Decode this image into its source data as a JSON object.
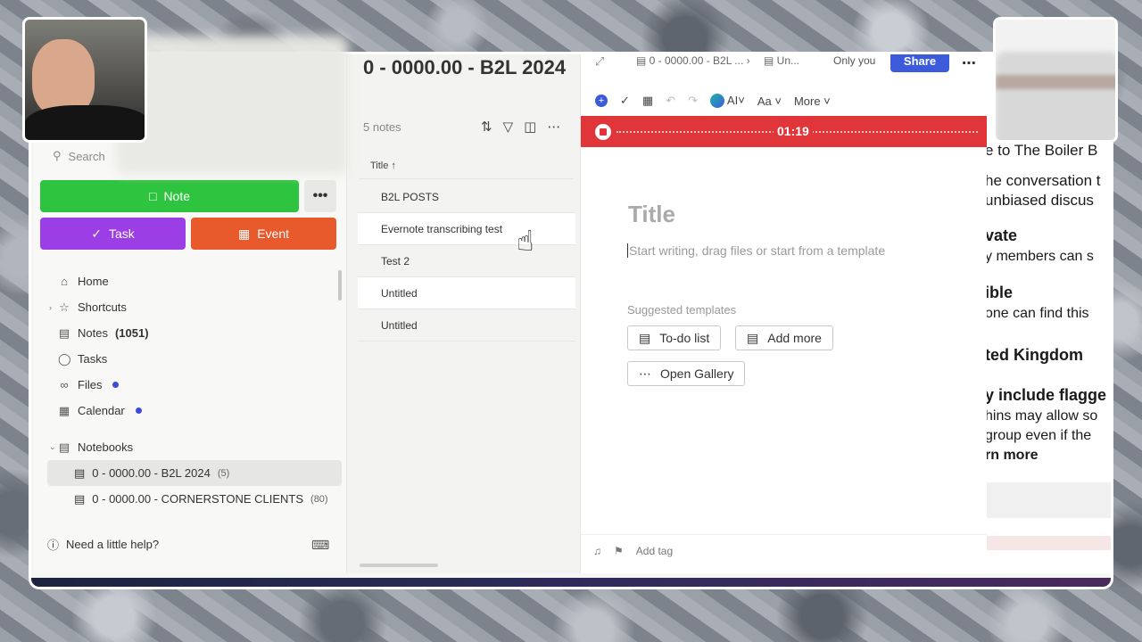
{
  "sidebar": {
    "search_placeholder": "Search",
    "buttons": {
      "note": "Note",
      "more": "•••",
      "task": "Task",
      "event": "Event"
    },
    "nav": [
      {
        "label": "Home",
        "icon": "home-icon"
      },
      {
        "label": "Shortcuts",
        "icon": "star-icon"
      },
      {
        "label": "Notes",
        "count": "(1051)",
        "icon": "note-icon"
      },
      {
        "label": "Tasks",
        "icon": "check-circle-icon"
      },
      {
        "label": "Files",
        "icon": "paperclip-icon"
      },
      {
        "label": "Calendar",
        "icon": "calendar-icon"
      }
    ],
    "notebooks_label": "Notebooks",
    "notebooks": [
      {
        "label": "0 - 0000.00 - B2L 2024",
        "count": "(5)"
      },
      {
        "label": "0 - 0000.00 - CORNERSTONE CLIENTS",
        "count": "(80)"
      }
    ],
    "help": "Need a little help?"
  },
  "notelist": {
    "title": "0 - 0000.00 - B2L 2024",
    "count": "5 notes",
    "column_header": "Title ↑",
    "rows": [
      "B2L POSTS",
      "Evernote transcribing test",
      "Test 2",
      "Untitled",
      "Untitled"
    ]
  },
  "editor": {
    "crumb1": "0 - 0000.00 - B2L ...",
    "crumb2": "Un...",
    "visibility": "Only you",
    "share": "Share",
    "toolbar": {
      "ai": "AI",
      "font": "Aa",
      "more": "More"
    },
    "recording_time": "01:19",
    "title_placeholder": "Title",
    "body_placeholder": "Start writing, drag files or start from a template",
    "suggested_label": "Suggested templates",
    "templates": {
      "todo": "To-do list",
      "add_more": "Add more",
      "gallery": "Open Gallery"
    },
    "add_tag": "Add tag"
  },
  "rightpage": {
    "lines": [
      "e to The Boiler B",
      "he conversation t",
      "unbiased discus",
      "vate",
      "y members can s",
      "ible",
      "one can find this",
      "ted Kingdom",
      "y include flagge",
      "hins may allow so",
      "group even if the",
      "rn more"
    ]
  },
  "colors": {
    "note_button": "#2ec43f",
    "task_button": "#9c3ee6",
    "event_button": "#e8592c",
    "share_button": "#3b5bdb",
    "recording_bar": "#e0363a"
  }
}
